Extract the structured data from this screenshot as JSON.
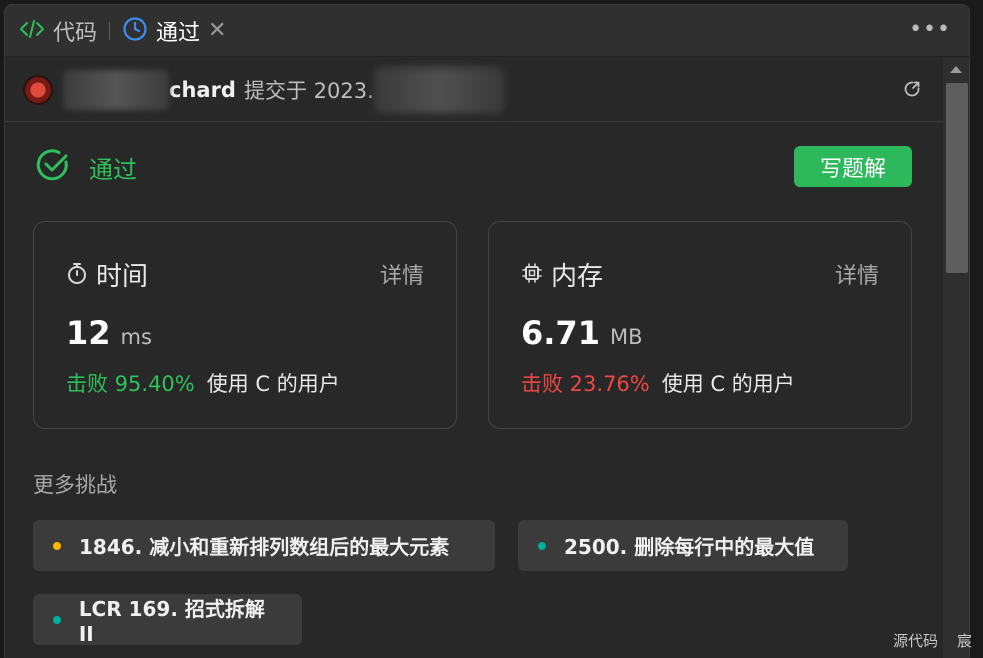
{
  "tabs": {
    "code_label": "代码",
    "pass_label": "通过",
    "close": "✕",
    "more": "•••"
  },
  "submitter": {
    "name_tail": "chard",
    "submit_text": "提交于 2023."
  },
  "status": {
    "label": "通过",
    "write_solution": "写题解"
  },
  "time_card": {
    "title": "时间",
    "detail": "详情",
    "value": "12",
    "unit": "ms",
    "beat": "击败 95.40%",
    "beat_suffix": "使用 C 的用户"
  },
  "memory_card": {
    "title": "内存",
    "detail": "详情",
    "value": "6.71",
    "unit": "MB",
    "beat": "击败 23.76%",
    "beat_suffix": "使用 C 的用户"
  },
  "more": {
    "title": "更多挑战",
    "items": [
      {
        "label": "1846. 减小和重新排列数组后的最大元素",
        "dot_color": "#ffb800"
      },
      {
        "label": "2500. 删除每行中的最大值",
        "dot_color": "#00af9b"
      },
      {
        "label": "LCR 169. 招式拆解 II",
        "dot_color": "#00af9b"
      }
    ]
  },
  "footer": {
    "source_label": "源代码",
    "extra": "宸"
  },
  "colors": {
    "accent_green": "#2ec05a",
    "accent_red": "#ef4743",
    "tab_blue": "#3b8ff0"
  }
}
